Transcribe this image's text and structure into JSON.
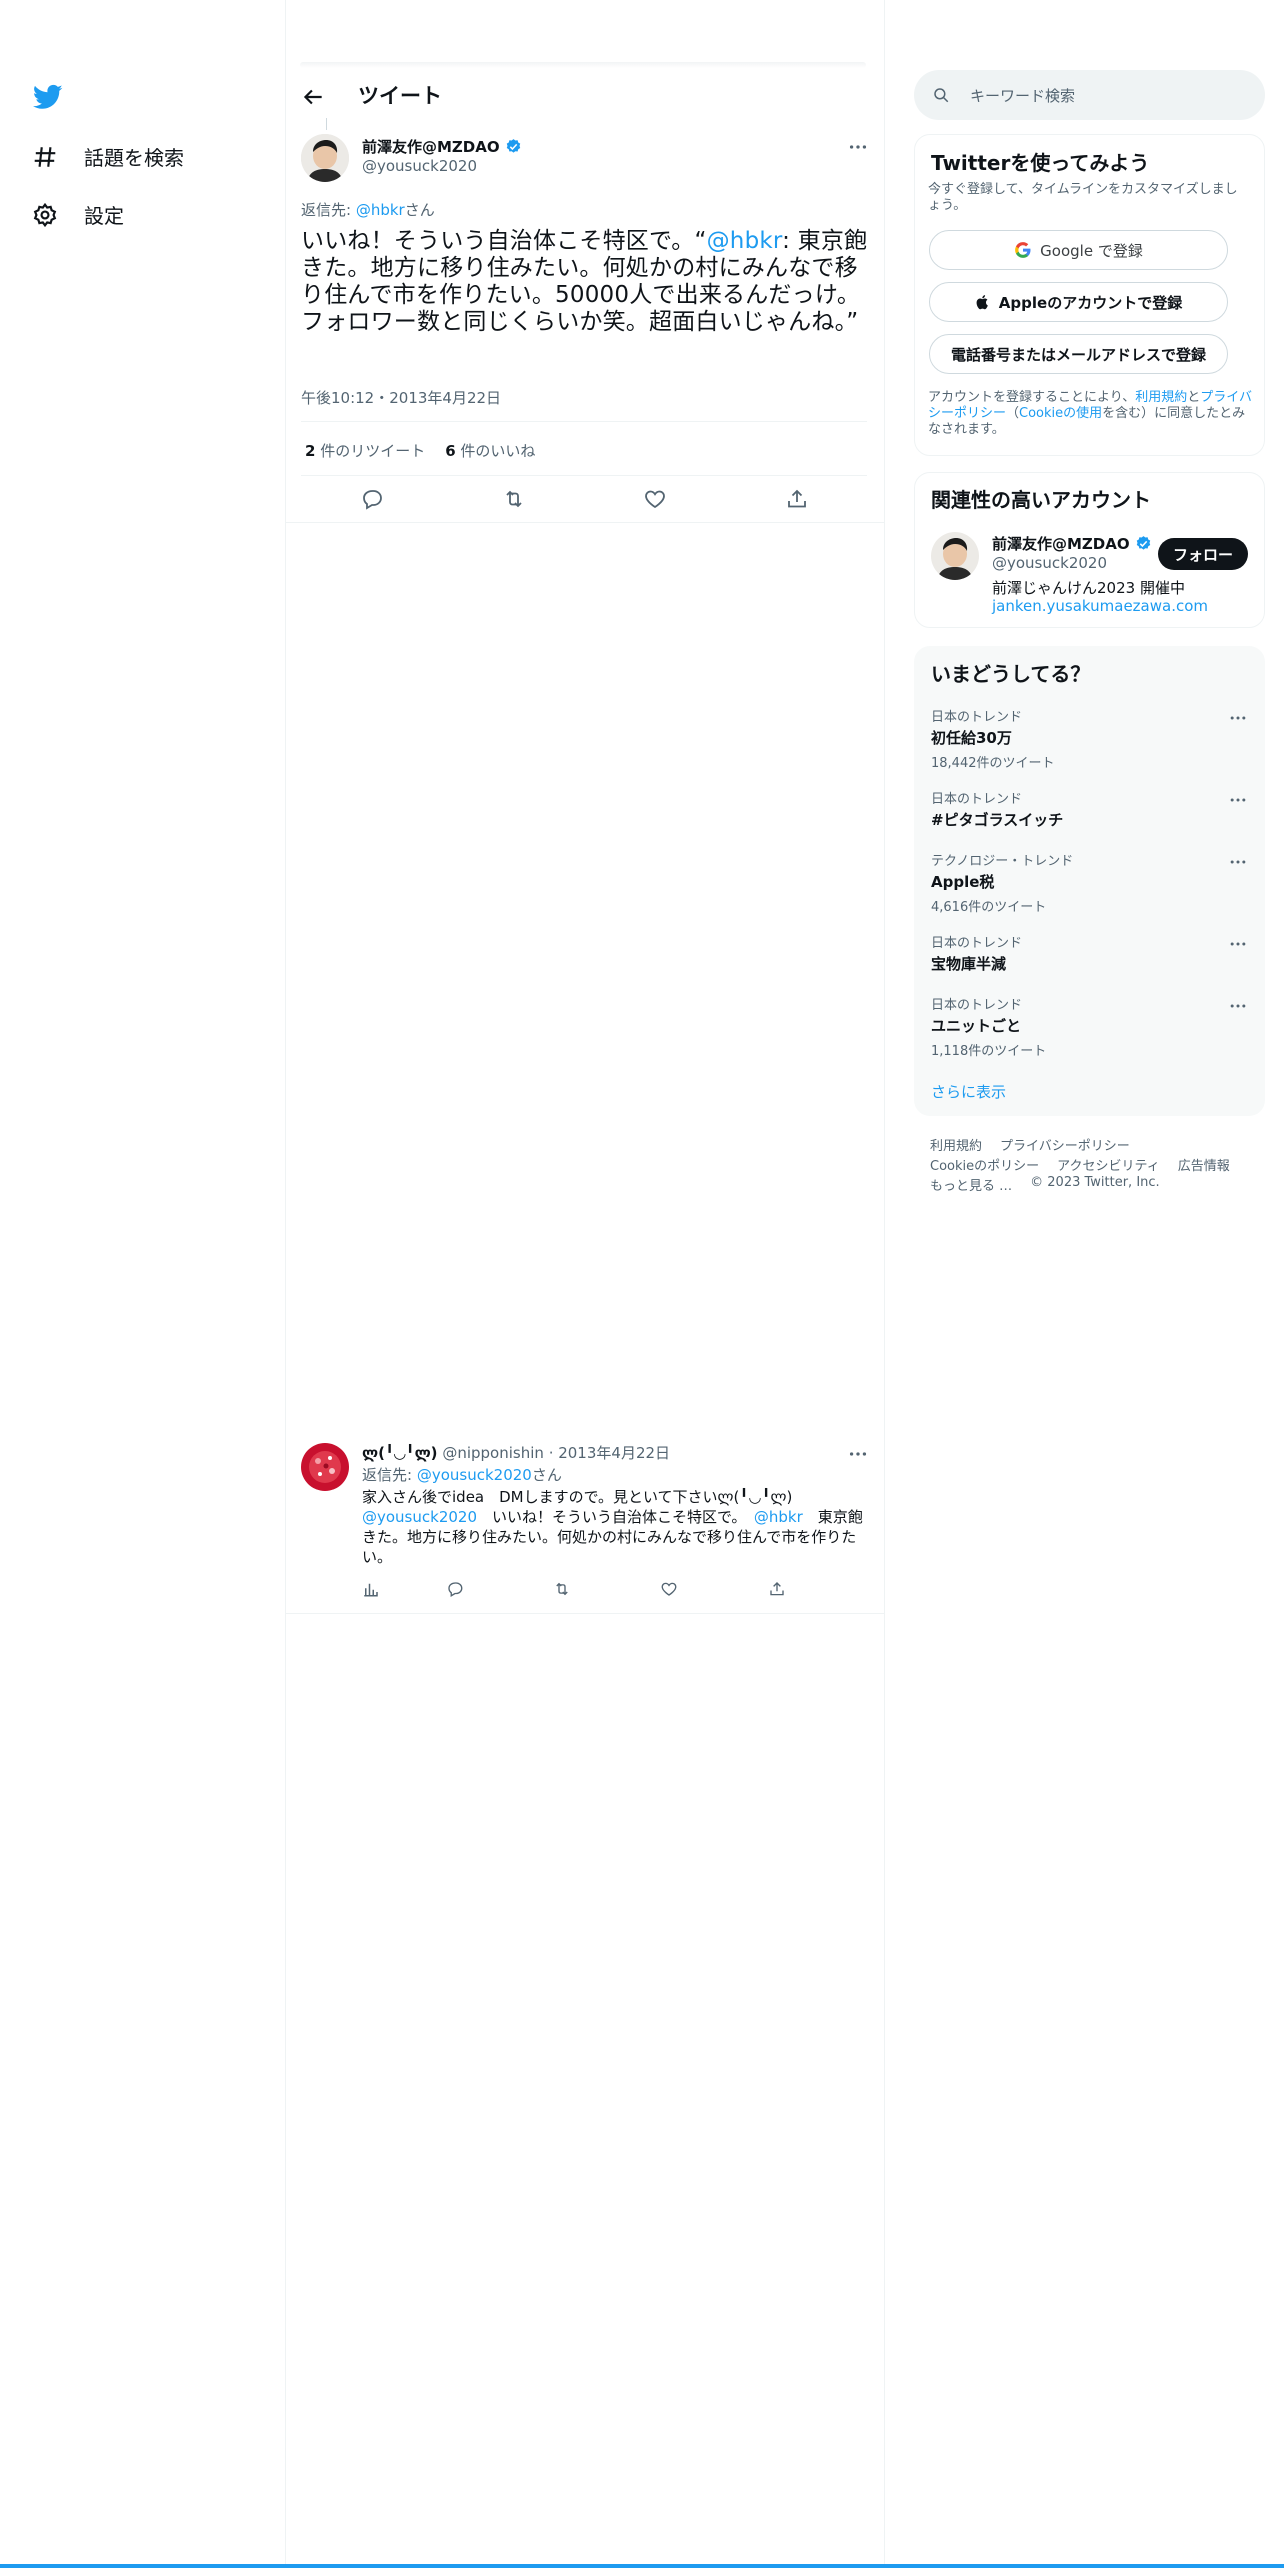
{
  "nav": {
    "items": [
      {
        "label": "話題を検索",
        "icon": "hashtag-icon"
      },
      {
        "label": "設定",
        "icon": "gear-icon"
      }
    ]
  },
  "header": {
    "title": "ツイート"
  },
  "tweet": {
    "author_name": "前澤友作@MZDAO",
    "author_handle": "@yousuck2020",
    "reply_prefix": "返信先: ",
    "reply_handle": "@hbkr",
    "reply_suffix": "さん",
    "text_part1": "いいね！そういう自治体こそ特区で。“",
    "text_mention": "@hbkr",
    "text_part2": ": 東京飽きた。地方に移り住みたい。何処かの村にみんなで移り住んで市を作りたい。50000人で出来るんだっけ。フォロワー数と同じくらいか笑。超面白いじゃんね。”",
    "timestamp": "午後10:12・2013年4月22日",
    "retweet_count": "2",
    "retweet_label": " 件のリツイート",
    "like_count": "6",
    "like_label": " 件のいいね"
  },
  "reply": {
    "author_name": "ლ(╹◡╹ლ)",
    "author_handle": "@nipponishin",
    "date": "· 2013年4月22日",
    "reply_prefix": "返信先: ",
    "reply_handle": "@yousuck2020",
    "reply_suffix": "さん",
    "line1": "家入さん後でidea　DMしますので。見といて下さいლ(╹◡╹ლ)",
    "mention1": "@yousuck2020",
    "line2a": "　いいね！そういう自治体こそ特区で。　",
    "mention2": "@hbkr",
    "line2b": "　東京飽きた。地方に移り住みたい。何処かの村にみんなで移り住んで市を作りたい。"
  },
  "search": {
    "placeholder": "キーワード検索"
  },
  "signup": {
    "title": "Twitterを使ってみよう",
    "subtitle": "今すぐ登録して、タイムラインをカスタマイズしましょう。",
    "google_label": "Google で登録",
    "apple_label": "Appleのアカウントで登録",
    "phone_label": "電話番号またはメールアドレスで登録",
    "legal_1": "アカウントを登録することにより、",
    "legal_terms": "利用規約",
    "legal_2": "と",
    "legal_privacy": "プライバシーポリシー",
    "legal_3": "（",
    "legal_cookie": "Cookieの使用",
    "legal_4": "を含む）に同意したとみなされます。"
  },
  "related": {
    "title": "関連性の高いアカウント",
    "name": "前澤友作@MZDAO",
    "handle": "@yousuck2020",
    "bio": "前澤じゃんけん2023 開催中",
    "link": "janken.yusakumaezawa.com",
    "follow_label": "フォロー"
  },
  "trends": {
    "title": "いまどうしてる？",
    "items": [
      {
        "category": "日本のトレンド",
        "name": "初任給30万",
        "count": "18,442件のツイート"
      },
      {
        "category": "日本のトレンド",
        "name": "#ピタゴラスイッチ",
        "count": ""
      },
      {
        "category": "テクノロジー・トレンド",
        "name": "Apple税",
        "count": "4,616件のツイート"
      },
      {
        "category": "日本のトレンド",
        "name": "宝物庫半減",
        "count": ""
      },
      {
        "category": "日本のトレンド",
        "name": "ユニットごと",
        "count": "1,118件のツイート"
      }
    ],
    "show_more": "さらに表示"
  },
  "footer": {
    "links": [
      "利用規約",
      "プライバシーポリシー",
      "Cookieのポリシー",
      "アクセシビリティ",
      "広告情報",
      "もっと見る …"
    ],
    "copyright": "© 2023 Twitter, Inc."
  },
  "colors": {
    "accent": "#1d9bf0",
    "text": "#0f1419",
    "muted": "#536471"
  }
}
